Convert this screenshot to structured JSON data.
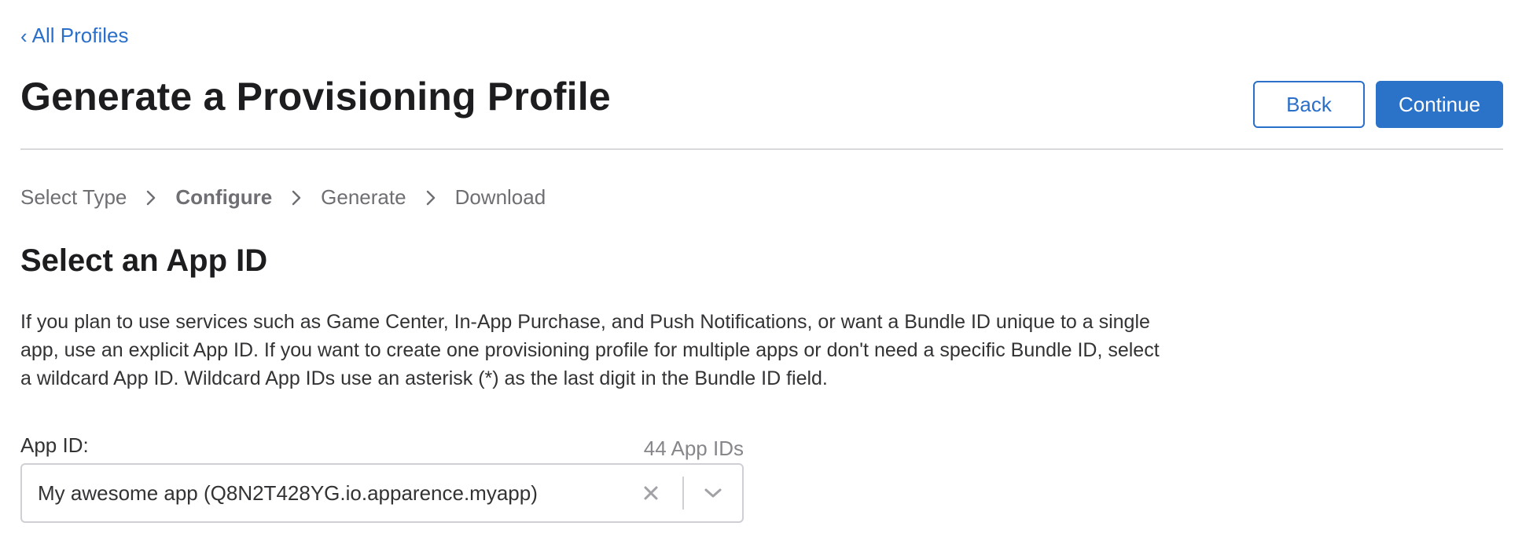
{
  "nav": {
    "back_link_label": "All Profiles"
  },
  "header": {
    "title": "Generate a Provisioning Profile",
    "back_button": "Back",
    "continue_button": "Continue"
  },
  "steps": [
    {
      "label": "Select Type",
      "active": false
    },
    {
      "label": "Configure",
      "active": true
    },
    {
      "label": "Generate",
      "active": false
    },
    {
      "label": "Download",
      "active": false
    }
  ],
  "section": {
    "title": "Select an App ID",
    "description": "If you plan to use services such as Game Center, In-App Purchase, and Push Notifications, or want a Bundle ID unique to a single app, use an explicit App ID. If you want to create one provisioning profile for multiple apps or don't need a specific Bundle ID, select a wildcard App ID. Wildcard App IDs use an asterisk (*) as the last digit in the Bundle ID field."
  },
  "app_id_field": {
    "label": "App ID:",
    "count": "44 App IDs",
    "selected_value": "My awesome app (Q8N2T428YG.io.apparence.myapp)"
  },
  "colors": {
    "accent": "#2a6fc9",
    "text": "#1d1d1f",
    "muted": "#6e6e73",
    "border": "#cfcfd4"
  },
  "icons": {
    "back": "chevron-left-icon",
    "step_separator": "chevron-right-icon",
    "clear": "close-icon",
    "dropdown": "chevron-down-icon"
  }
}
